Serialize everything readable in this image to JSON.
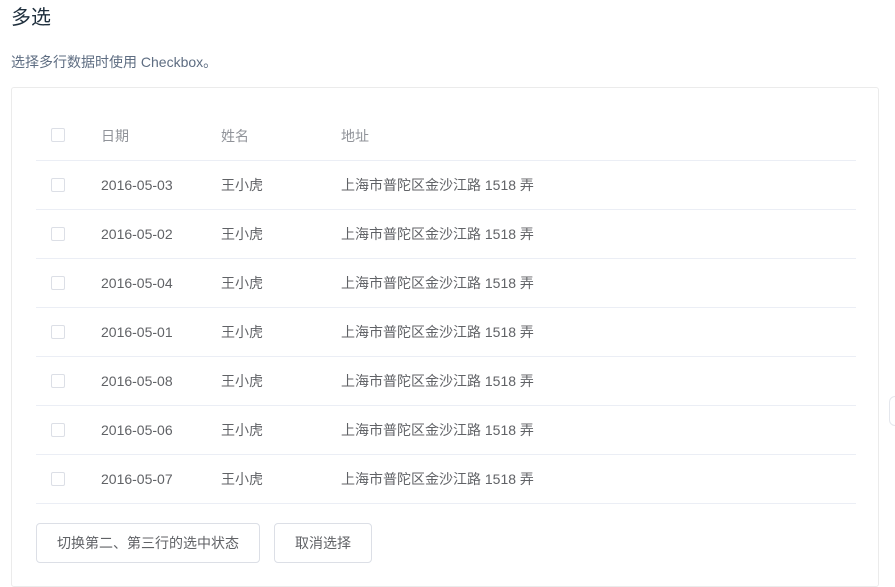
{
  "section": {
    "title": "多选",
    "description": "选择多行数据时使用 Checkbox。"
  },
  "table": {
    "columns": [
      "日期",
      "姓名",
      "地址"
    ],
    "rows": [
      {
        "date": "2016-05-03",
        "name": "王小虎",
        "address": "上海市普陀区金沙江路 1518 弄",
        "checked": false
      },
      {
        "date": "2016-05-02",
        "name": "王小虎",
        "address": "上海市普陀区金沙江路 1518 弄",
        "checked": false
      },
      {
        "date": "2016-05-04",
        "name": "王小虎",
        "address": "上海市普陀区金沙江路 1518 弄",
        "checked": false
      },
      {
        "date": "2016-05-01",
        "name": "王小虎",
        "address": "上海市普陀区金沙江路 1518 弄",
        "checked": false
      },
      {
        "date": "2016-05-08",
        "name": "王小虎",
        "address": "上海市普陀区金沙江路 1518 弄",
        "checked": false
      },
      {
        "date": "2016-05-06",
        "name": "王小虎",
        "address": "上海市普陀区金沙江路 1518 弄",
        "checked": false
      },
      {
        "date": "2016-05-07",
        "name": "王小虎",
        "address": "上海市普陀区金沙江路 1518 弄",
        "checked": false
      }
    ]
  },
  "buttons": {
    "toggle_label": "切换第二、第三行的选中状态",
    "clear_label": "取消选择"
  },
  "colors": {
    "title": "#1f2f3d",
    "text": "#606266",
    "header_text": "#909399",
    "border": "#ebeef5"
  }
}
